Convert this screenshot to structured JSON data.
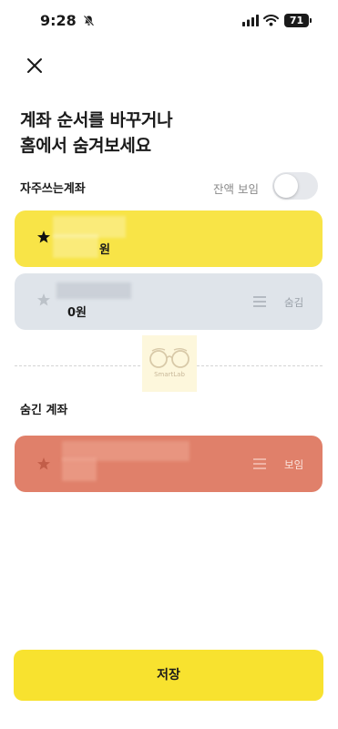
{
  "status_bar": {
    "time": "9:28",
    "battery": "71"
  },
  "header": {
    "title_line1": "계좌 순서를 바꾸거나",
    "title_line2": "홈에서 숨겨보세요"
  },
  "frequent_section": {
    "label": "자주쓰는계좌",
    "balance_toggle_label": "잔액 보임",
    "balance_visible": false
  },
  "accounts": [
    {
      "starred": true,
      "balance": "원",
      "action_label": ""
    },
    {
      "starred": false,
      "balance": "0원",
      "action_label": "숨김"
    }
  ],
  "hidden_section": {
    "label": "숨긴 계좌",
    "accounts": [
      {
        "starred": false,
        "balance": "",
        "action_label": "보임"
      }
    ]
  },
  "watermark": {
    "text": "SmartLab"
  },
  "footer": {
    "save_label": "저장"
  },
  "colors": {
    "frequent_card": "#f8e447",
    "gray_card": "#dfe4ea",
    "hidden_card": "#e0806a",
    "save_button": "#f8e22f"
  }
}
